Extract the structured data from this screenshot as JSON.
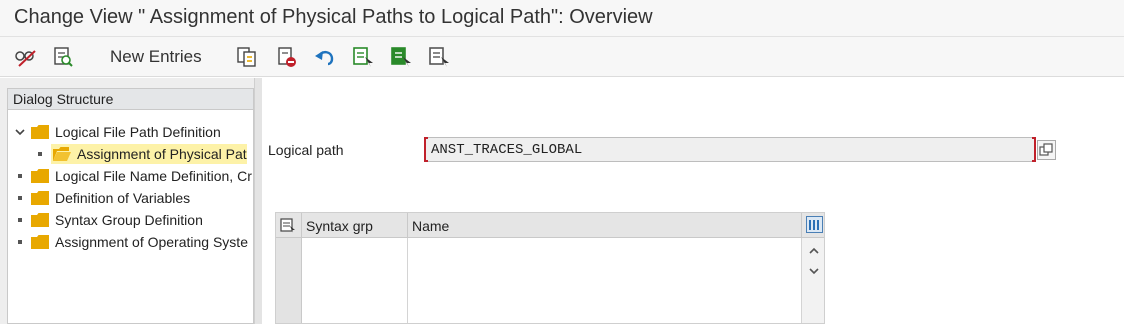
{
  "window": {
    "title": "Change View \" Assignment of Physical Paths to Logical Path\": Overview"
  },
  "toolbar": {
    "new_entries_label": "New Entries"
  },
  "dialog_structure": {
    "header": "Dialog Structure",
    "items": [
      {
        "label": "Logical File Path Definition"
      },
      {
        "label": "Assignment of Physical Pat"
      },
      {
        "label": "Logical File Name Definition, Cr"
      },
      {
        "label": "Definition of Variables"
      },
      {
        "label": "Syntax Group Definition"
      },
      {
        "label": "Assignment of Operating Syste"
      }
    ]
  },
  "form": {
    "logical_path_label": "Logical path",
    "logical_path_value": "ANST_TRACES_GLOBAL"
  },
  "table": {
    "columns": [
      "Syntax grp",
      "Name"
    ]
  },
  "colors": {
    "accent_required": "#c0202a",
    "folder": "#e8a800",
    "selected": "#fdf2a8"
  }
}
